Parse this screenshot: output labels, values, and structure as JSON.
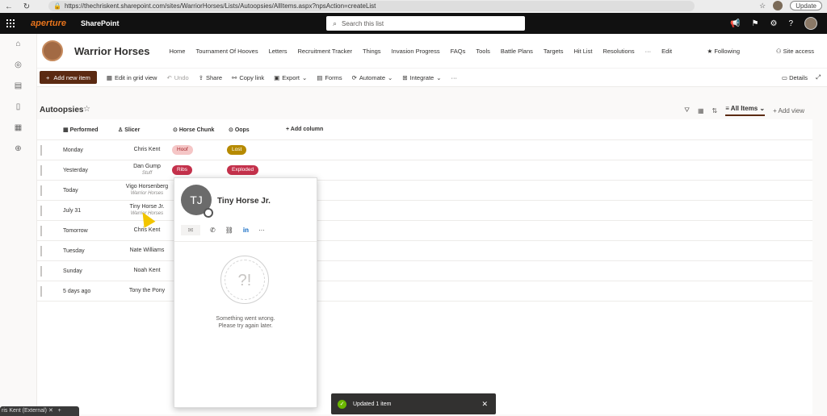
{
  "browser": {
    "url": "https://thechriskent.sharepoint.com/sites/WarriorHorses/Lists/Autoopsies/AllItems.aspx?npsAction=createList",
    "update_label": "Update"
  },
  "suite": {
    "logo": "aperture",
    "app": "SharePoint",
    "search_placeholder": "Search this list"
  },
  "site": {
    "title": "Warrior Horses",
    "nav": [
      "Home",
      "Tournament Of Hooves",
      "Letters",
      "Recruitment Tracker",
      "Things",
      "Invasion Progress",
      "FAQs",
      "Tools",
      "Battle Plans",
      "Targets",
      "Hit List",
      "Resolutions",
      "···",
      "Edit"
    ],
    "following": "Following",
    "site_access": "Site access"
  },
  "commands": {
    "add": "Add new item",
    "grid": "Edit in grid view",
    "undo": "Undo",
    "share": "Share",
    "copy": "Copy link",
    "export": "Export",
    "forms": "Forms",
    "automate": "Automate",
    "integrate": "Integrate",
    "more": "···",
    "details": "Details"
  },
  "view": {
    "title": "Autoopsies",
    "all_items": "All Items",
    "add_view": "Add view"
  },
  "columns": {
    "c1": "Performed",
    "c2": "Slicer",
    "c3": "Horse Chunk",
    "c4": "Oops",
    "add": "Add column"
  },
  "rows": [
    {
      "performed": "Monday",
      "slicer": "Chris Kent",
      "sub": "",
      "chunk": "Hoof",
      "oops": "Lost"
    },
    {
      "performed": "Yesterday",
      "slicer": "Dan Gump",
      "sub": "Stuff",
      "chunk": "Ribs",
      "oops": "Exploded"
    },
    {
      "performed": "Today",
      "slicer": "Vigo Horsenberg",
      "sub": "Warrior Horses",
      "chunk": "",
      "oops": ""
    },
    {
      "performed": "July 31",
      "slicer": "Tiny Horse Jr.",
      "sub": "Warrior Horses",
      "chunk": "",
      "oops": ""
    },
    {
      "performed": "Tomorrow",
      "slicer": "Chris Kent",
      "sub": "",
      "chunk": "",
      "oops": ""
    },
    {
      "performed": "Tuesday",
      "slicer": "Nate Williams",
      "sub": "",
      "chunk": "",
      "oops": ""
    },
    {
      "performed": "Sunday",
      "slicer": "Noah Kent",
      "sub": "",
      "chunk": "",
      "oops": ""
    },
    {
      "performed": "5 days ago",
      "slicer": "Tony the Pony",
      "sub": "",
      "chunk": "",
      "oops": ""
    }
  ],
  "card": {
    "initials": "TJ",
    "name": "Tiny Horse Jr.",
    "error_icon": "?!",
    "error1": "Something went wrong.",
    "error2": "Please try again later."
  },
  "toast": {
    "text": "Updated 1 item"
  },
  "bottom_tab": "ris Kent (External)",
  "colors": {
    "brand": "#5b2a12",
    "hoof": "#f5c6c6",
    "ribs": "#c4314b",
    "lost": "#b68a00",
    "exploded": "#c4314b"
  }
}
